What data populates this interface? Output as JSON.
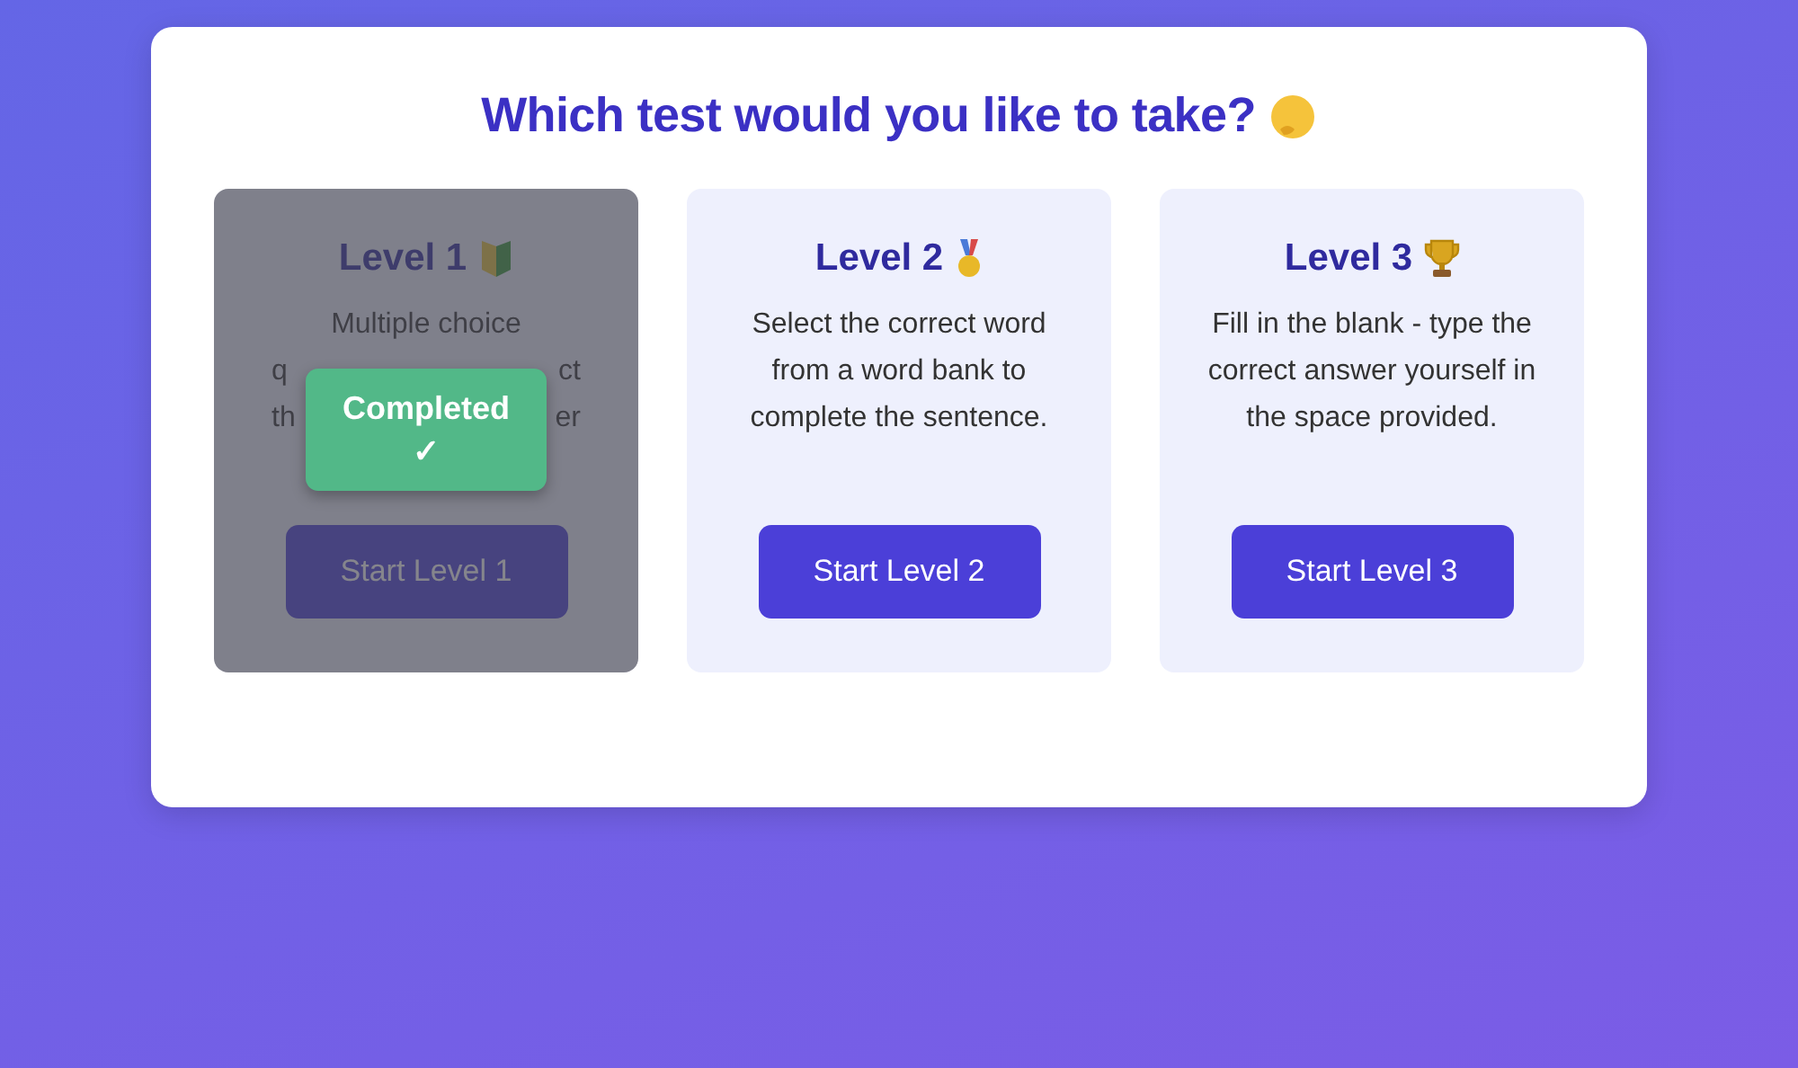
{
  "heading": "Which test would you like to take?",
  "levels": [
    {
      "title": "Level 1",
      "kind": "leaf",
      "completed": true,
      "completed_label": "Completed",
      "completed_mark": "✓",
      "visible_lines": [
        [
          "Multiple choice"
        ],
        [
          "q",
          "ct"
        ],
        [
          "th",
          "er"
        ]
      ],
      "button": "Start Level 1"
    },
    {
      "title": "Level 2",
      "kind": "medal",
      "completed": false,
      "description": "Select the correct word from a word bank to complete the sentence.",
      "button": "Start Level 2"
    },
    {
      "title": "Level 3",
      "kind": "trophy",
      "completed": false,
      "description": "Fill in the blank - type the correct answer yourself in the space provided.",
      "button": "Start Level 3"
    }
  ]
}
